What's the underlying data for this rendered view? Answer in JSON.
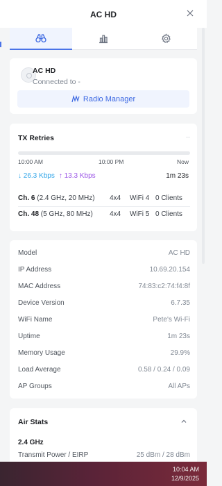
{
  "header": {
    "title": "AC HD"
  },
  "tabs": [
    {
      "name": "overview",
      "icon": "binoculars-icon",
      "active": true
    },
    {
      "name": "statistics",
      "icon": "bar-chart-icon",
      "active": false
    },
    {
      "name": "settings",
      "icon": "gear-icon",
      "active": false
    }
  ],
  "device": {
    "name": "AC HD",
    "status": "Connected to -",
    "radio_manager_label": "Radio Manager"
  },
  "tx_retries": {
    "title": "TX Retries",
    "timeline": [
      "10:00 AM",
      "10:00 PM",
      "Now"
    ],
    "download_rate": "↓ 26.3 Kbps",
    "upload_rate": "↑ 13.3 Kbps",
    "uptime": "1m 23s",
    "channels": [
      {
        "channel": "Ch. 6",
        "band": "(2.4 GHz, 20 MHz)",
        "mimo": "4x4",
        "wifi": "WiFi 4",
        "clients": "0 Clients"
      },
      {
        "channel": "Ch. 48",
        "band": "(5 GHz, 80 MHz)",
        "mimo": "4x4",
        "wifi": "WiFi 5",
        "clients": "0 Clients"
      }
    ]
  },
  "info": [
    {
      "label": "Model",
      "value": "AC HD"
    },
    {
      "label": "IP Address",
      "value": "10.69.20.154"
    },
    {
      "label": "MAC Address",
      "value": "74:83:c2:74:f4:8f"
    },
    {
      "label": "Device Version",
      "value": "6.7.35"
    },
    {
      "label": "WiFi Name",
      "value": "Pete's Wi-Fi"
    },
    {
      "label": "Uptime",
      "value": "1m 23s"
    },
    {
      "label": "Memory Usage",
      "value": "29.9%"
    },
    {
      "label": "Load Average",
      "value": "0.58 / 0.24 / 0.09"
    },
    {
      "label": "AP Groups",
      "value": "All APs"
    }
  ],
  "air_stats": {
    "title": "Air Stats",
    "band": "2.4 GHz",
    "transmit_label": "Transmit Power / EIRP",
    "transmit_value": "25 dBm / 28 dBm"
  },
  "taskbar": {
    "time": "10:04 AM",
    "date": "12/9/2025"
  },
  "colors": {
    "accent": "#3c68e2",
    "download": "#2ea4e8",
    "upload": "#9a53e6"
  }
}
